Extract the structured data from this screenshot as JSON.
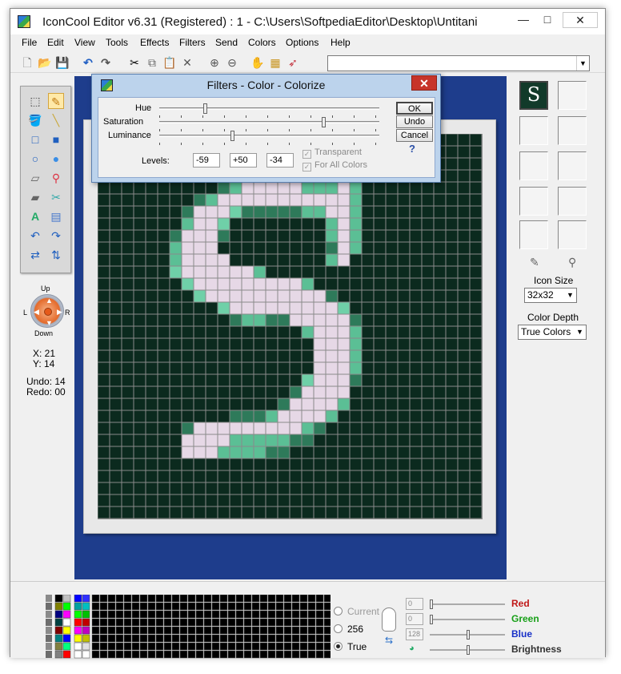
{
  "window": {
    "title": "IconCool Editor v6.31 (Registered) : 1 - C:\\Users\\SoftpediaEditor\\Desktop\\Untitani",
    "min": "—",
    "max": "□",
    "close": "✕"
  },
  "menu": [
    "File",
    "Edit",
    "View",
    "Tools",
    "Effects",
    "Filters",
    "Send",
    "Colors",
    "Options",
    "Help"
  ],
  "toolbar_icons": [
    "new-icon",
    "open-icon",
    "save-icon",
    "undo-icon",
    "redo-icon",
    "cut-icon",
    "copy-icon",
    "paste-icon",
    "delete-icon",
    "zoom-in-icon",
    "zoom-out-icon",
    "hand-icon",
    "film-icon",
    "picker-icon"
  ],
  "nav": {
    "up": "Up",
    "down": "Down",
    "left": "L",
    "right": "R"
  },
  "status": {
    "x": "X: 21",
    "y": "Y: 14",
    "undo": "Undo: 14",
    "redo": "Redo: 00"
  },
  "icon_preview_letter": "S",
  "right_panel": {
    "icon_size_label": "Icon Size",
    "icon_size_value": "32x32",
    "color_depth_label": "Color Depth",
    "color_depth_value": "True Colors"
  },
  "dialog": {
    "title": "Filters - Color - Colorize",
    "hue": "Hue",
    "saturation": "Saturation",
    "luminance": "Luminance",
    "levels_label": "Levels:",
    "levels": [
      "-59",
      "+50",
      "-34"
    ],
    "transparent": "Transparent",
    "for_all_colors": "For All Colors",
    "ok": "OK",
    "undo": "Undo",
    "cancel": "Cancel",
    "help": "?",
    "hue_level": -59,
    "saturation_level": 50,
    "luminance_level": -34
  },
  "color_modes": {
    "current": "Current",
    "c256": "256",
    "true": "True",
    "selected": "True"
  },
  "channels": [
    {
      "name": "Red",
      "value": "0",
      "color": "#c01818"
    },
    {
      "name": "Green",
      "value": "0",
      "color": "#18a018"
    },
    {
      "name": "Blue",
      "value": "128",
      "color": "#1830c8"
    },
    {
      "name": "Brightness",
      "value": "",
      "color": "#333333"
    }
  ],
  "canvas_colors": {
    "background": "#0b2a1e",
    "light": "#e6d8e6",
    "mid": "#5bbf95",
    "mid2": "#6fd0a8",
    "dark": "#2e7a5a"
  }
}
